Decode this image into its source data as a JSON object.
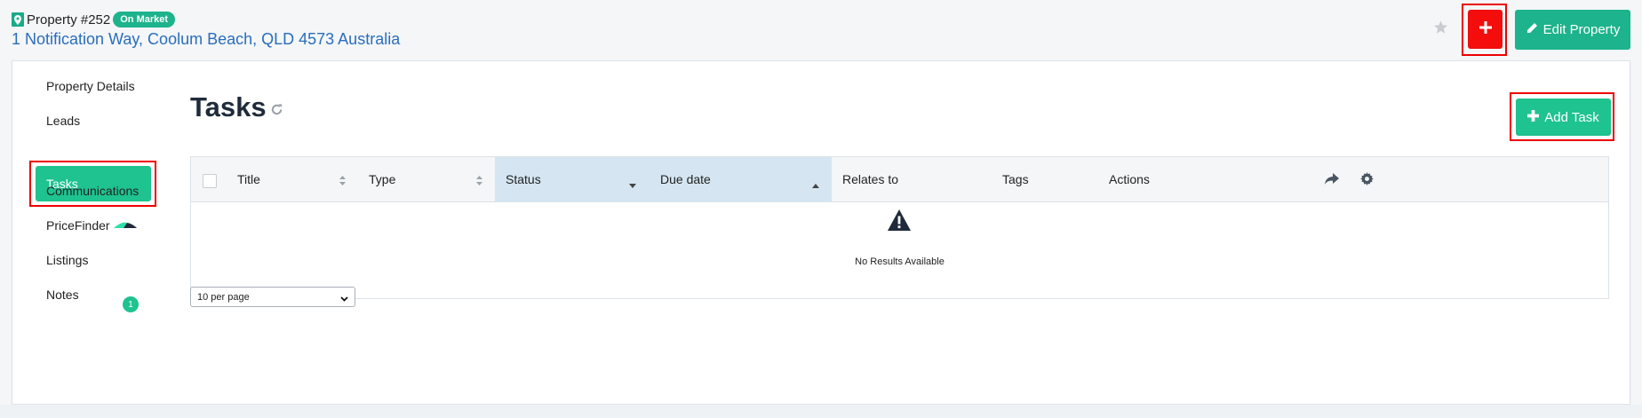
{
  "header": {
    "property_number": "Property #252",
    "status_badge": "On Market",
    "address": "1 Notification Way, Coolum Beach, QLD 4573 Australia",
    "edit_button": "Edit Property"
  },
  "sidebar": {
    "items": [
      {
        "label": "Property Details"
      },
      {
        "label": "Leads"
      },
      {
        "label": "Tasks",
        "active": true
      },
      {
        "label": "Communications"
      },
      {
        "label": "PriceFinder"
      },
      {
        "label": "Listings",
        "count": "1"
      },
      {
        "label": "Notes"
      }
    ]
  },
  "main": {
    "title": "Tasks",
    "add_task_button": "Add Task",
    "table": {
      "columns": [
        "Title",
        "Type",
        "Status",
        "Due date",
        "Relates to",
        "Tags",
        "Actions"
      ],
      "empty_message": "No Results Available"
    },
    "per_page": "10 per page"
  },
  "colors": {
    "accent": "#1ec38f",
    "danger": "#f30d0d",
    "link": "#2a6ebb",
    "sorted_header": "#d5e6f2"
  }
}
